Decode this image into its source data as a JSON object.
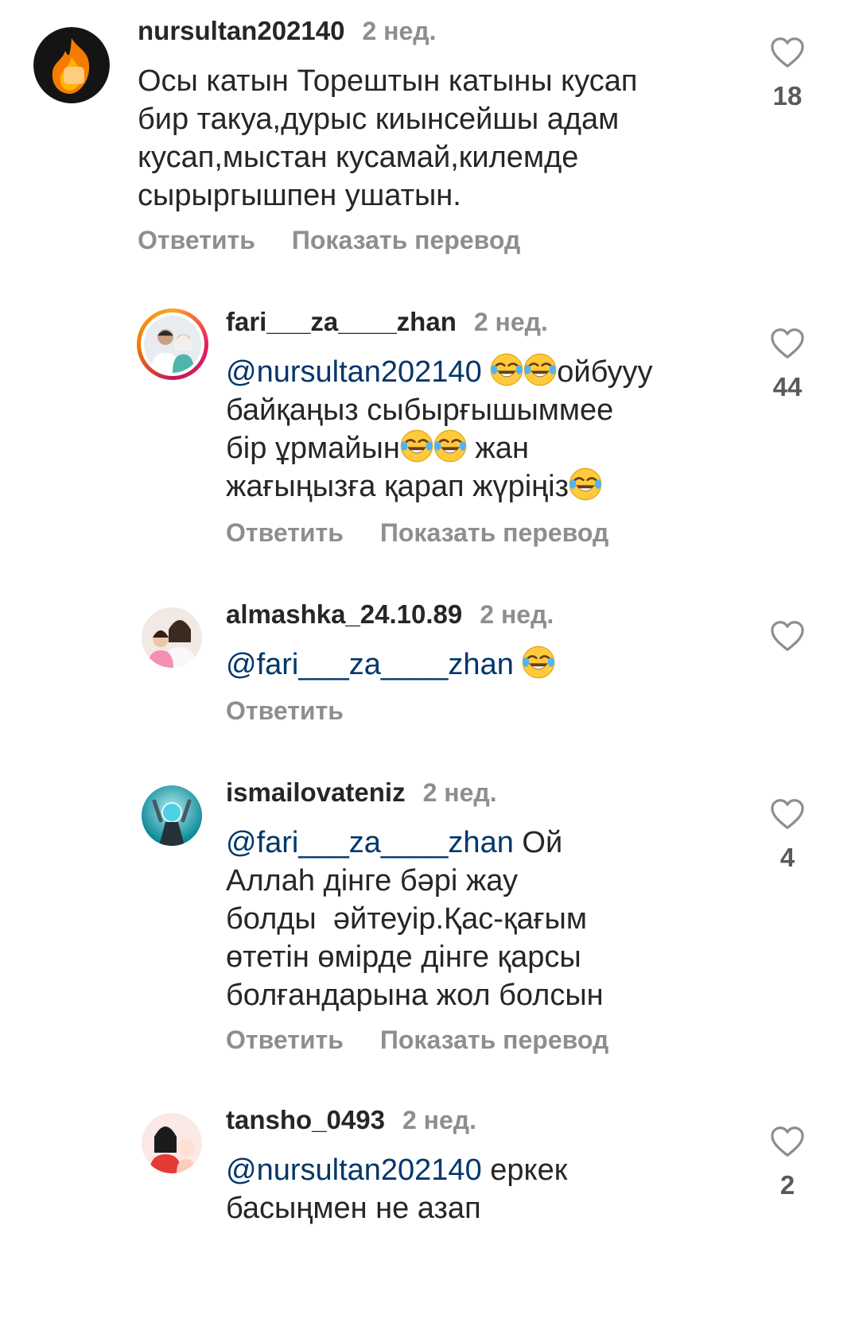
{
  "comments": [
    {
      "username": "nursultan202140",
      "time": "2 нед.",
      "lines": [
        "Осы катын Торештын катыны кусап",
        "бир такуа,дурыс киынсейшы адам",
        "кусап,мыстан кусамай,килемде",
        "сырыргышпен ушатын."
      ],
      "reply_label": "Ответить",
      "translate_label": "Показать перевод",
      "likes": "18"
    },
    {
      "username": "fari___za____zhan",
      "time": "2 нед.",
      "mention": "@nursultan202140",
      "text_after_mention": "ойбууу",
      "line2": "байқаңыз сыбырғышыммее",
      "line3_a": "бір ұрмайын",
      "line3_b": " жан",
      "line4": "жағыңызға қарап жүріңіз",
      "reply_label": "Ответить",
      "translate_label": "Показать перевод",
      "likes": "44"
    },
    {
      "username": "almashka_24.10.89",
      "time": "2 нед.",
      "mention": "@fari___za____zhan",
      "reply_label": "Ответить"
    },
    {
      "username": "ismailovateniz",
      "time": "2 нед.",
      "mention": "@fari___za____zhan",
      "text_after_mention": " Ой",
      "lines": [
        "Аллаһ дінге бәрі жау",
        "болды  әйтеуір.Қас-қағым",
        "өтетін өмірде дінге қарсы",
        "болғандарына жол болсын"
      ],
      "reply_label": "Ответить",
      "translate_label": "Показать перевод",
      "likes": "4"
    },
    {
      "username": "tansho_0493",
      "time": "2 нед.",
      "mention": "@nursultan202140",
      "text_after_mention": " еркек",
      "lines": [
        "басыңмен не азап"
      ],
      "likes": "2"
    }
  ],
  "icons": {
    "like": "heart-outline-icon",
    "emoji": "face-with-tears-of-joy-emoji"
  },
  "colors": {
    "text": "#262626",
    "secondary": "#8e8e8e",
    "mention": "#00376b"
  }
}
